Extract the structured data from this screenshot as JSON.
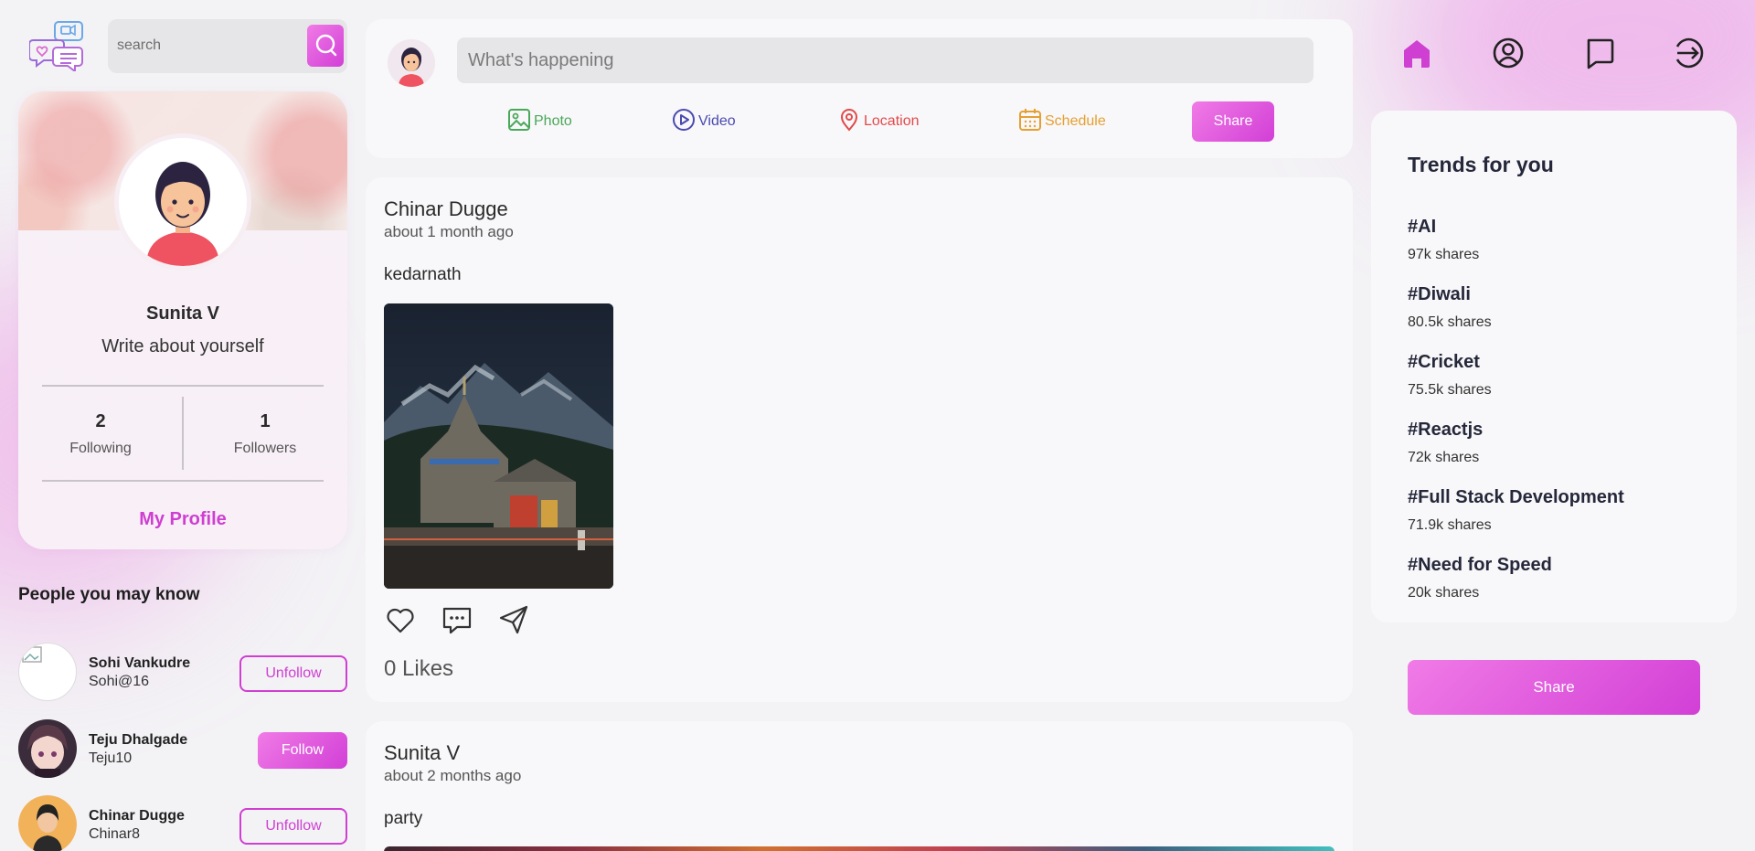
{
  "search": {
    "placeholder": "search"
  },
  "profile": {
    "name": "Sunita V",
    "bio": "Write about yourself",
    "following_count": "2",
    "following_label": "Following",
    "followers_count": "1",
    "followers_label": "Followers",
    "link": "My Profile"
  },
  "people": {
    "title": "People you may know",
    "items": [
      {
        "name": "Sohi Vankudre",
        "handle": "Sohi@16",
        "action": "Unfollow",
        "avatar_icon": "broken-image-icon"
      },
      {
        "name": "Teju Dhalgade",
        "handle": "Teju10",
        "action": "Follow",
        "avatar_icon": "anime-avatar"
      },
      {
        "name": "Chinar Dugge",
        "handle": "Chinar8",
        "action": "Unfollow",
        "avatar_icon": "avatar-orange"
      }
    ]
  },
  "composer": {
    "placeholder": "What's happening",
    "options": {
      "photo": "Photo",
      "video": "Video",
      "location": "Location",
      "schedule": "Schedule"
    },
    "share": "Share"
  },
  "posts": [
    {
      "author": "Chinar Dugge",
      "time": "about 1 month ago",
      "text": "kedarnath",
      "likes": "0 Likes",
      "image": "kedarnath-temple-photo"
    },
    {
      "author": "Sunita V",
      "time": "about 2 months ago",
      "text": "party"
    }
  ],
  "nav": [
    "home-icon",
    "profile-icon",
    "chat-icon",
    "logout-icon"
  ],
  "trends": {
    "title": "Trends for you",
    "items": [
      {
        "tag": "#AI",
        "shares": "97k shares"
      },
      {
        "tag": "#Diwali",
        "shares": "80.5k shares"
      },
      {
        "tag": "#Cricket",
        "shares": "75.5k shares"
      },
      {
        "tag": "#Reactjs",
        "shares": "72k shares"
      },
      {
        "tag": "#Full Stack Development",
        "shares": "71.9k shares"
      },
      {
        "tag": "#Need for Speed",
        "shares": "20k shares"
      }
    ]
  },
  "share_button": "Share",
  "colors": {
    "accent": "#cf3fd2",
    "accent_light": "#f07be6",
    "photo": "#4aa85a",
    "video": "#4a4ab0",
    "location": "#e14b4b",
    "schedule": "#e6a030"
  }
}
